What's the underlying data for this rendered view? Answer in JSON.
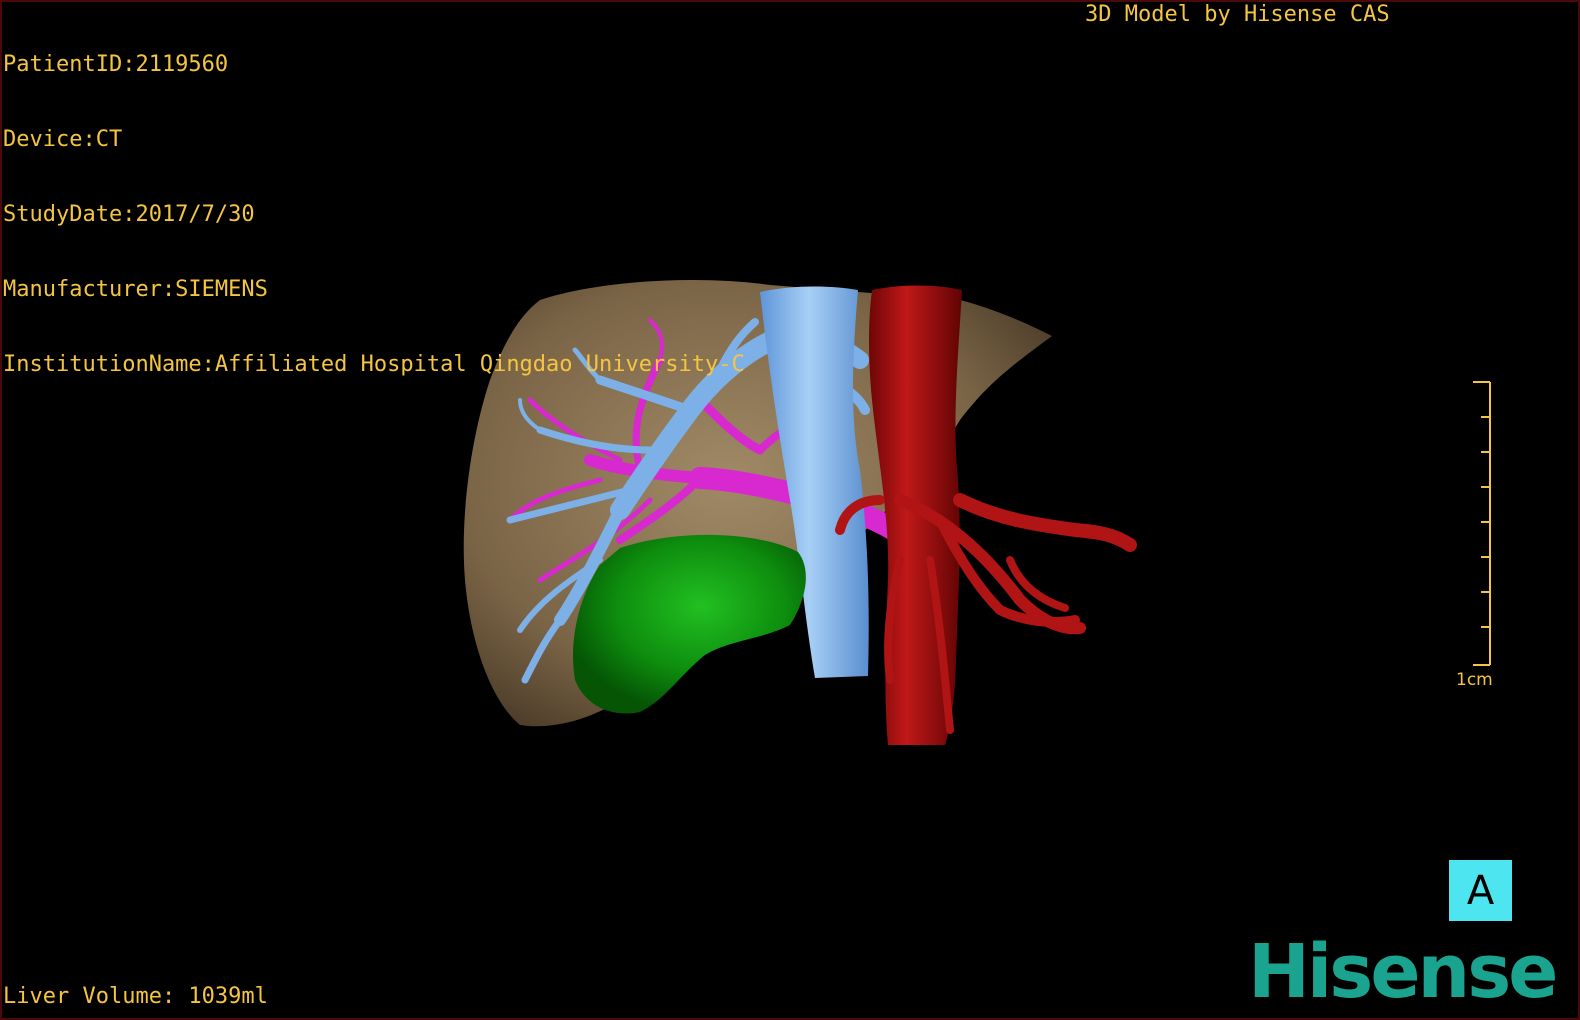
{
  "header": {
    "patient_id": "PatientID:2119560",
    "device": "Device:CT",
    "study_date": "StudyDate:2017/7/30",
    "manufacturer": "Manufacturer:SIEMENS",
    "institution": "InstitutionName:Affiliated Hospital Qingdao University-C"
  },
  "credit": "3D Model by Hisense CAS",
  "footer": {
    "liver_volume": "Liver Volume: 1039ml"
  },
  "scale_bar": {
    "label": "1cm"
  },
  "orientation": {
    "label": "A"
  },
  "logo": {
    "text": "Hisense"
  },
  "colors": {
    "text": "#f5c542",
    "liver": "#8a7355",
    "portal_vein": "#7eb0e8",
    "hepatic_artery": "#d828d0",
    "aorta": "#a81010",
    "kidney": "#0c8a0c",
    "orientation_bg": "#4de6f0",
    "logo": "#1aa38f"
  }
}
